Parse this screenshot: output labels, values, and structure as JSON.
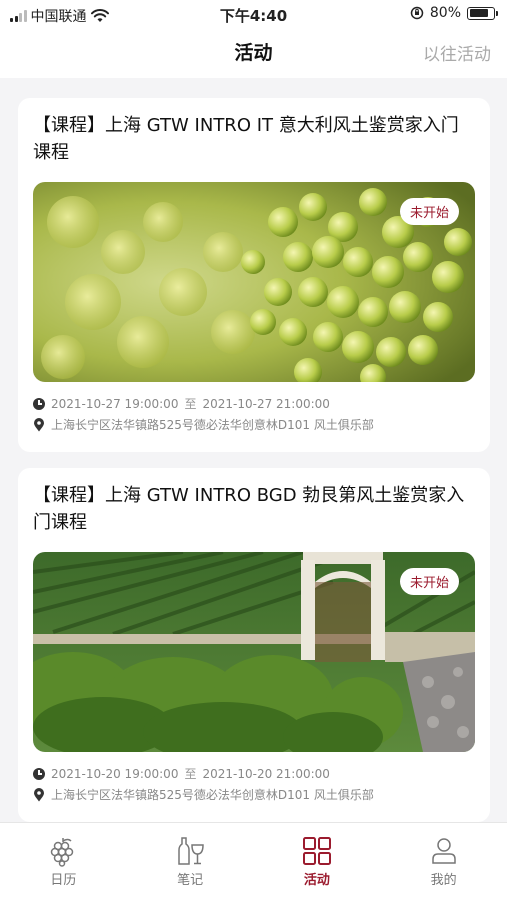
{
  "status_bar": {
    "carrier": "中国联通",
    "time": "下午4:40",
    "battery": "80%",
    "battery_level": 0.8
  },
  "header": {
    "title": "活动",
    "right_link": "以往活动"
  },
  "events": [
    {
      "title": "【课程】上海 GTW INTRO IT 意大利风土鉴赏家入门课程",
      "status": "未开始",
      "start": "2021-10-27 19:00:00",
      "sep": "至",
      "end": "2021-10-27 21:00:00",
      "location": "上海长宁区法华镇路525号德必法华创意林D101 风土俱乐部",
      "image": "grapes-photo"
    },
    {
      "title": "【课程】上海 GTW INTRO BGD 勃艮第风土鉴赏家入门课程",
      "status": "未开始",
      "start": "2021-10-20 19:00:00",
      "sep": "至",
      "end": "2021-10-20 21:00:00",
      "location": "上海长宁区法华镇路525号德必法华创意林D101 风土俱乐部",
      "image": "vineyard-photo"
    }
  ],
  "tabs": [
    {
      "label": "日历",
      "icon": "grape-icon",
      "active": false
    },
    {
      "label": "笔记",
      "icon": "wine-glass-icon",
      "active": false
    },
    {
      "label": "活动",
      "icon": "grid-icon",
      "active": true
    },
    {
      "label": "我的",
      "icon": "person-icon",
      "active": false
    }
  ],
  "colors": {
    "accent": "#9b1b2e",
    "background": "#f4f4f6"
  }
}
